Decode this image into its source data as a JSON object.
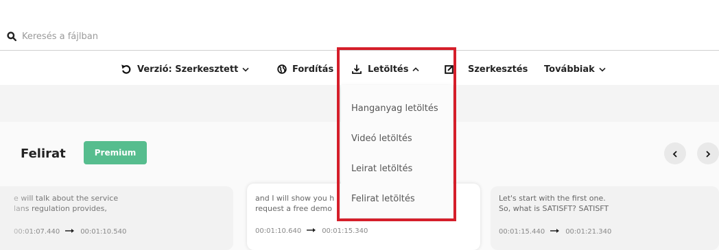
{
  "search": {
    "placeholder": "Keresés a fájlban",
    "icon": "search-icon"
  },
  "toolbar": {
    "version_label": "Verzió: Szerkesztett",
    "translate_label": "Fordítás",
    "download_label": "Letöltés",
    "edit_label": "Szerkesztés",
    "more_label": "Továbbiak"
  },
  "download_menu": {
    "items": [
      {
        "label": "Hanganyag letöltés"
      },
      {
        "label": "Videó letöltés"
      },
      {
        "label": "Leirat letöltés"
      },
      {
        "label": "Felirat letöltés"
      }
    ]
  },
  "section": {
    "title": "Felirat",
    "badge": "Premium"
  },
  "cards": [
    {
      "line1": "e will talk about the service",
      "line2": "lans regulation provides,",
      "start": "00:01:07.440",
      "end": "00:01:10.540"
    },
    {
      "line1": "and I will show you h",
      "line2": "request a free demo",
      "start": "00:01:10.640",
      "end": "00:01:15.340"
    },
    {
      "line1": "Let's start with the first one.",
      "line2": "So, what is SATISFT? SATISFT",
      "start": "00:01:15.440",
      "end": "00:01:21.340"
    }
  ],
  "colors": {
    "accent_green": "#56bd8e",
    "highlight_red": "#d51e2a",
    "dropdown_bg": "#fbfbfb"
  }
}
